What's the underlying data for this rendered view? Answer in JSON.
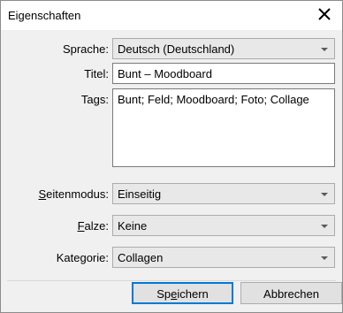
{
  "dialog": {
    "title": "Eigenschaften",
    "close_icon": "close-icon"
  },
  "fields": {
    "language": {
      "label": "Sprache:",
      "value": "Deutsch (Deutschland)"
    },
    "title": {
      "label": "Titel:",
      "value": "Bunt – Moodboard"
    },
    "tags": {
      "label": "Tags:",
      "value": "Bunt; Feld; Moodboard; Foto; Collage"
    },
    "page_mode": {
      "label_accel": "S",
      "label_rest": "eitenmodus:",
      "value": "Einseitig"
    },
    "folds": {
      "label_accel": "F",
      "label_rest": "alze:",
      "value": "Keine"
    },
    "category": {
      "label": "Kategorie:",
      "value": "Collagen"
    }
  },
  "buttons": {
    "save": {
      "pre": "Sp",
      "accel": "e",
      "post": "ichern"
    },
    "cancel": {
      "label": "Abbrechen"
    }
  }
}
